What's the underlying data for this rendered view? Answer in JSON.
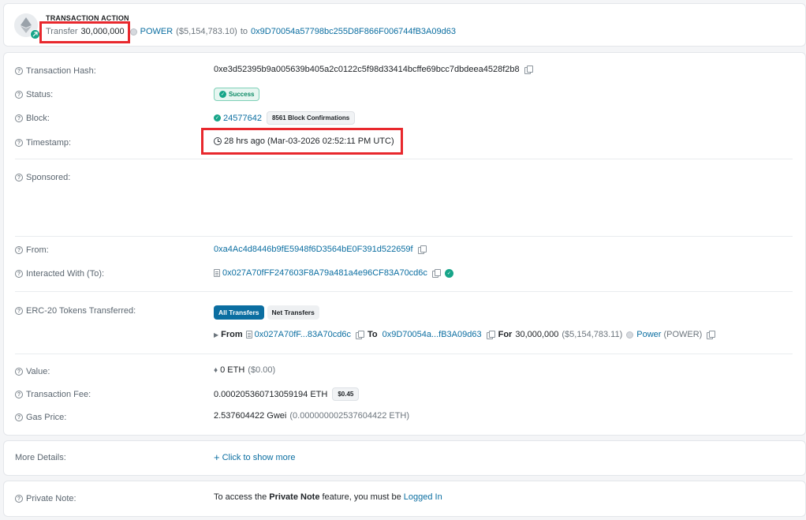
{
  "action": {
    "title": "TRANSACTION ACTION",
    "verb": "Transfer",
    "amount": "30,000,000",
    "token": "POWER",
    "usd": "($5,154,783.10)",
    "to_word": "to",
    "to_address": "0x9D70054a57798bc255D8F866F006744fB3A09d63"
  },
  "details": {
    "tx_hash": {
      "label": "Transaction Hash:",
      "value": "0xe3d52395b9a005639b405a2c0122c5f98d33414bcffe69bcc7dbdeea4528f2b8"
    },
    "status": {
      "label": "Status:",
      "value": "Success"
    },
    "block": {
      "label": "Block:",
      "number": "24577642",
      "confirmations": "8561 Block Confirmations"
    },
    "timestamp": {
      "label": "Timestamp:",
      "value": "28 hrs ago (Mar-03-2026 02:52:11 PM UTC)"
    },
    "sponsored": {
      "label": "Sponsored:"
    },
    "from": {
      "label": "From:",
      "value": "0xa4Ac4d8446b9fE5948f6D3564bE0F391d522659f"
    },
    "interacted": {
      "label": "Interacted With (To):",
      "value": "0x027A70fFF247603F8A79a481a4e96CF83A70cd6c"
    },
    "erc20": {
      "label": "ERC-20 Tokens Transferred:",
      "tab_all": "All Transfers",
      "tab_net": "Net Transfers",
      "from_word": "From",
      "from_addr": "0x027A70fF...83A70cd6c",
      "to_word": "To",
      "to_addr": "0x9D70054a...fB3A09d63",
      "for_word": "For",
      "amount": "30,000,000",
      "usd": "($5,154,783.11)",
      "token_name": "Power",
      "token_symbol": "(POWER)"
    },
    "value": {
      "label": "Value:",
      "eth": "0 ETH",
      "usd": "($0.00)"
    },
    "fee": {
      "label": "Transaction Fee:",
      "eth": "0.000205360713059194 ETH",
      "usd": "$0.45"
    },
    "gas": {
      "label": "Gas Price:",
      "gwei": "2.537604422 Gwei",
      "eth": "(0.000000002537604422 ETH)"
    }
  },
  "more": {
    "label": "More Details:",
    "link": "Click to show more"
  },
  "note": {
    "label": "Private Note:",
    "text_before": "To access the",
    "strong": "Private Note",
    "text_mid": "feature, you must be",
    "link": "Logged In"
  },
  "colors": {
    "link": "#0b6ea1",
    "success": "#17a589",
    "highlight": "#e8282d"
  },
  "icons": [
    "ethereum-logo-icon",
    "help-circle-icon",
    "copy-icon",
    "check-circle-icon",
    "clock-icon",
    "contract-doc-icon",
    "plus-icon"
  ]
}
